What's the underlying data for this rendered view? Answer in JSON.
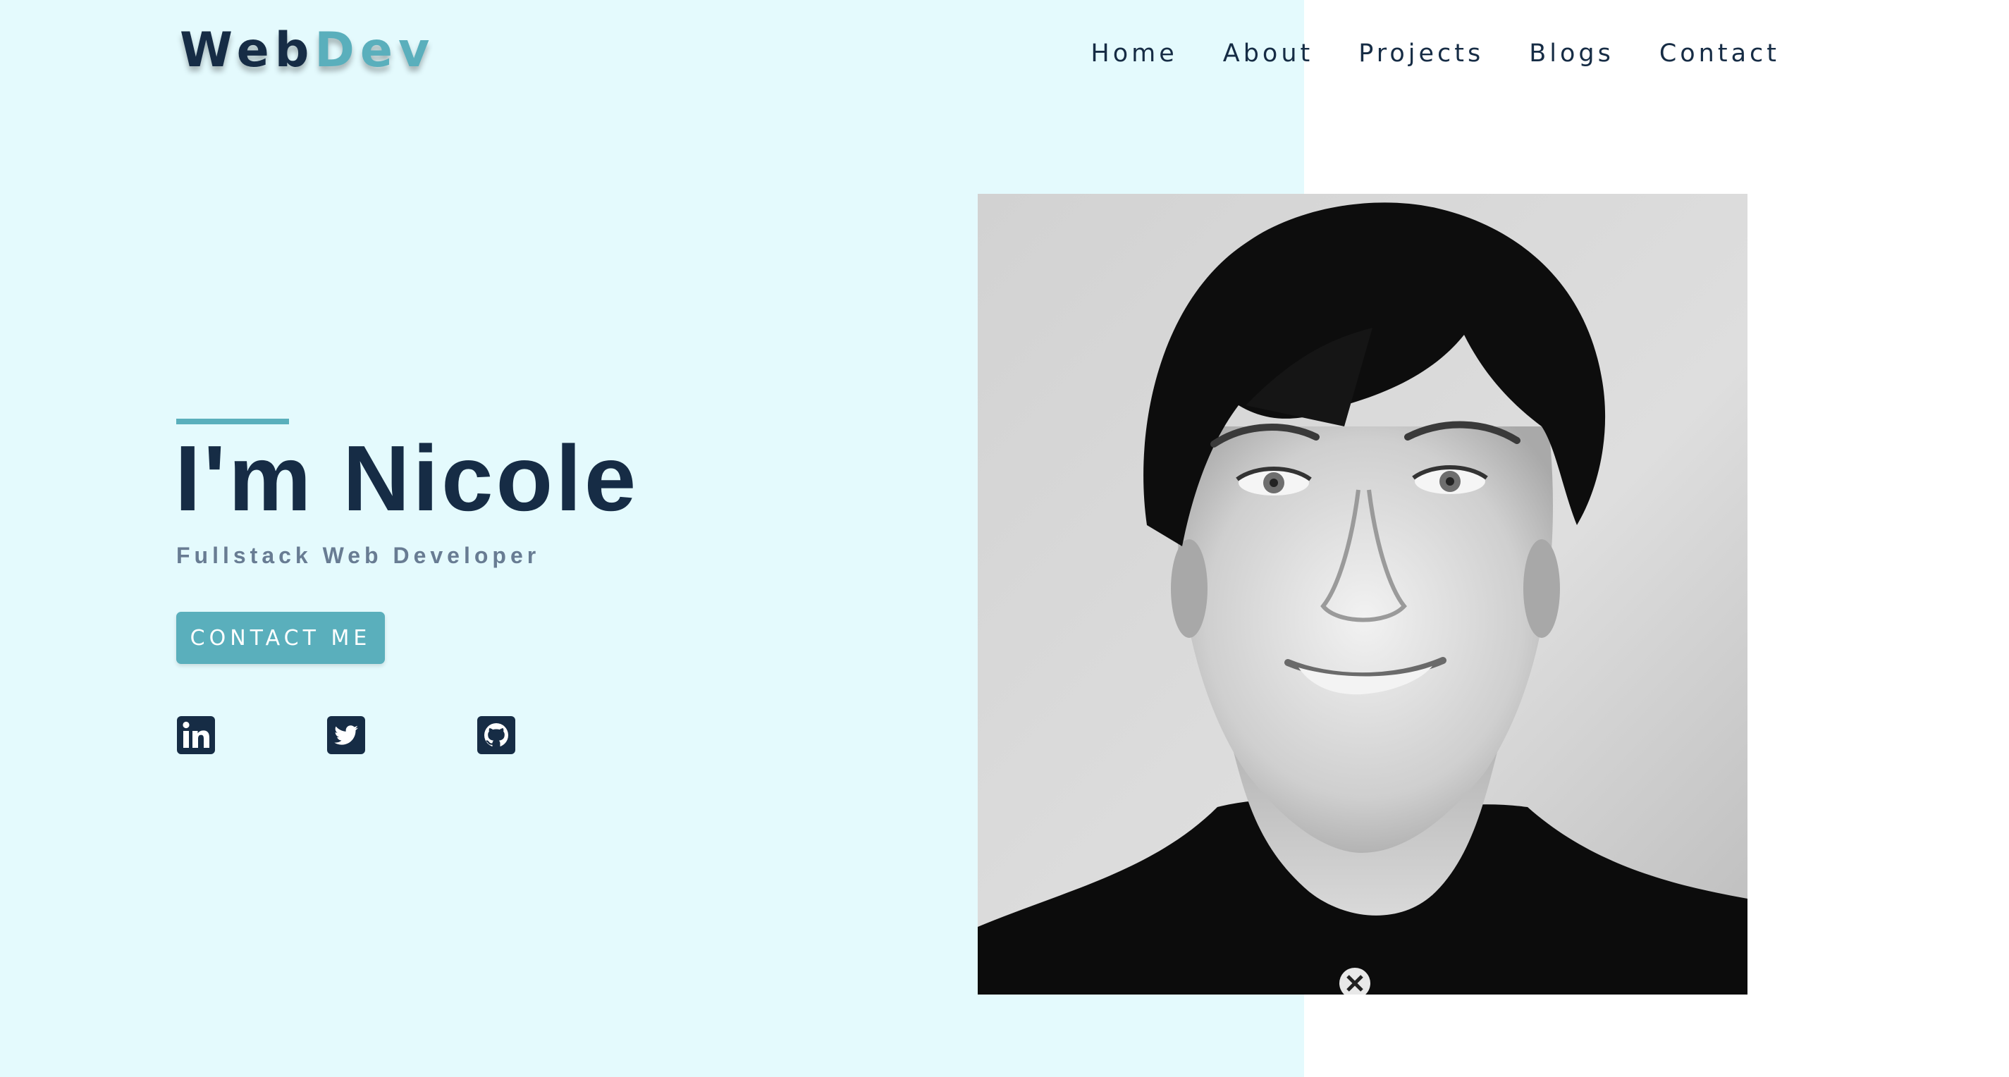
{
  "header": {
    "logo_part1": "Web",
    "logo_part2": "Dev",
    "nav": [
      {
        "label": "Home"
      },
      {
        "label": "About"
      },
      {
        "label": "Projects"
      },
      {
        "label": "Blogs"
      },
      {
        "label": "Contact"
      }
    ]
  },
  "hero": {
    "title": "I'm Nicole",
    "subtitle": "Fullstack Web Developer",
    "cta_label": "CONTACT ME",
    "social": [
      {
        "icon": "linkedin-icon"
      },
      {
        "icon": "twitter-icon"
      },
      {
        "icon": "github-icon"
      }
    ]
  },
  "colors": {
    "navy": "#162c45",
    "accent": "#5aafbc",
    "left_background": "#e4fafd",
    "subtitle": "#687c93"
  }
}
